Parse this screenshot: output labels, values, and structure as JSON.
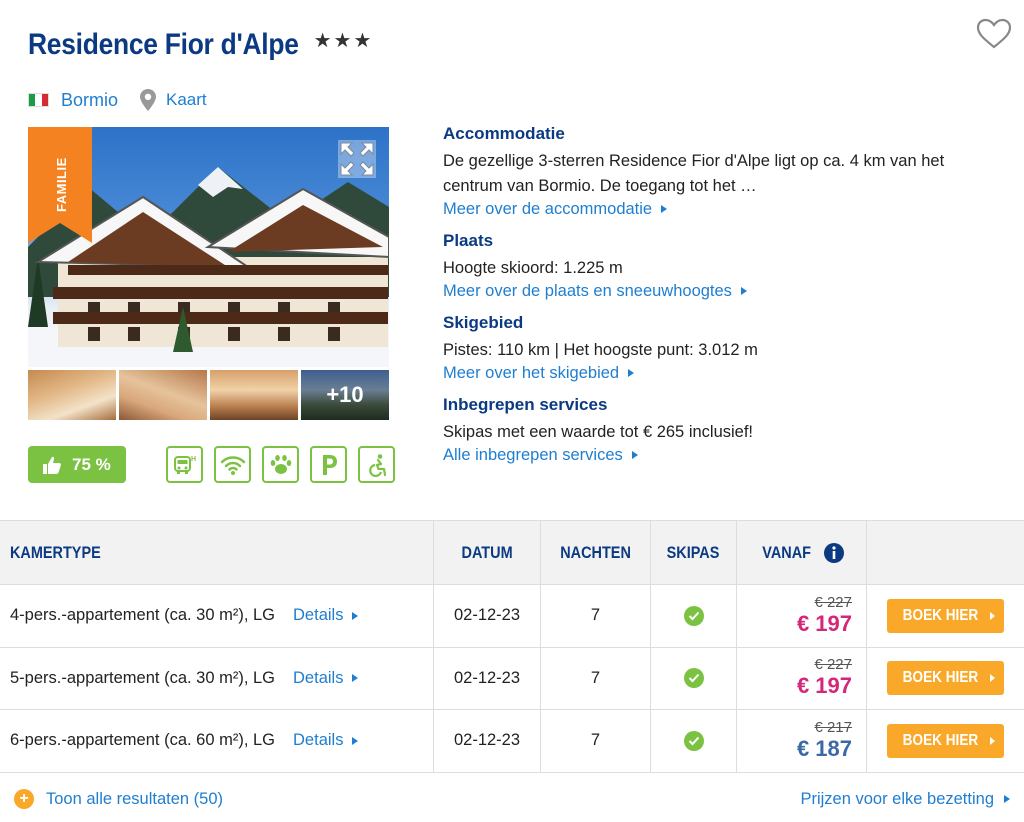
{
  "hotel": {
    "name": "Residence Fior d'Alpe",
    "stars": "★★★",
    "city": "Bormio",
    "map_label": "Kaart",
    "badge": "FAMILIE",
    "more_photos": "+10",
    "rating": "75 %"
  },
  "icons": {
    "favorite": "heart-icon",
    "location": "map-pin-icon",
    "expand": "expand-icon",
    "thumbs_up": "thumbs-up-icon",
    "amenities": [
      "shuttle-bus-icon",
      "wifi-icon",
      "pets-icon",
      "parking-icon",
      "wheelchair-icon"
    ]
  },
  "colors": {
    "brand_blue": "#0b3a82",
    "link_blue": "#1f7ed0",
    "green": "#7cc242",
    "orange": "#f9a82a",
    "price_pink": "#d6267a",
    "price_blue": "#3a6aa6"
  },
  "info": {
    "accommodation": {
      "heading": "Accommodatie",
      "text": "De gezellige 3-sterren Residence Fior d'Alpe ligt op ca. 4 km van het centrum van Bormio. De toegang tot het …",
      "link": "Meer over de accommodatie"
    },
    "place": {
      "heading": "Plaats",
      "text": "Hoogte skioord: 1.225 m",
      "link": "Meer over de plaats en sneeuwhoogtes"
    },
    "ski_area": {
      "heading": "Skigebied",
      "text": "Pistes: 110 km | Het hoogste punt: 3.012 m",
      "link": "Meer over het skigebied"
    },
    "services": {
      "heading": "Inbegrepen services",
      "text": "Skipas met een waarde tot € 265 inclusief!",
      "link": "Alle inbegrepen services"
    }
  },
  "table": {
    "headers": {
      "room_type": "KAMERTYPE",
      "date": "DATUM",
      "nights": "NACHTEN",
      "skipass": "SKIPAS",
      "from": "VANAF"
    },
    "rows": [
      {
        "room": "4-pers.-appartement (ca. 30 m²), LG",
        "details": "Details",
        "date": "02-12-23",
        "nights": "7",
        "skipass": true,
        "old_price": "€ 227",
        "price": "€ 197",
        "book": "BOEK HIER"
      },
      {
        "room": "5-pers.-appartement (ca. 30 m²), LG",
        "details": "Details",
        "date": "02-12-23",
        "nights": "7",
        "skipass": true,
        "old_price": "€ 227",
        "price": "€ 197",
        "book": "BOEK HIER"
      },
      {
        "room": "6-pers.-appartement (ca. 60 m²), LG",
        "details": "Details",
        "date": "02-12-23",
        "nights": "7",
        "skipass": true,
        "old_price": "€ 217",
        "price": "€ 187",
        "book": "BOEK HIER"
      }
    ]
  },
  "footer": {
    "show_all": "Toon alle resultaten (50)",
    "prices_link": "Prijzen voor elke bezetting"
  }
}
